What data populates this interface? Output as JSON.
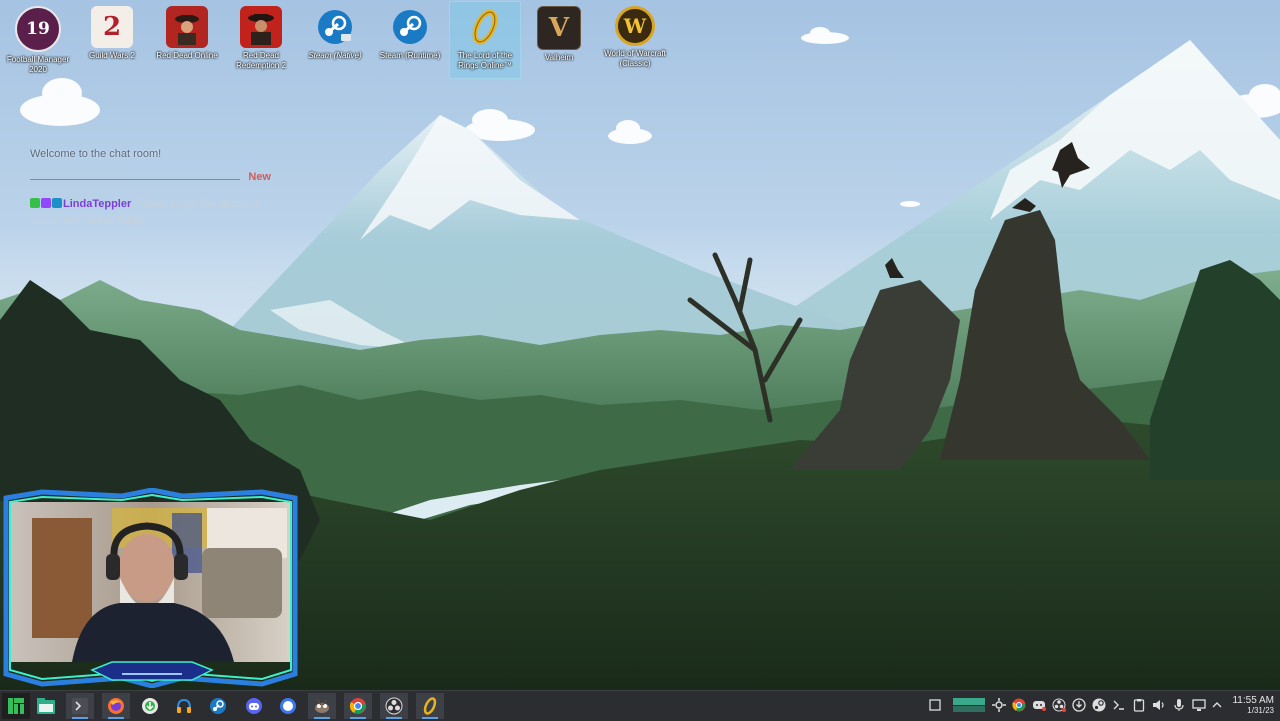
{
  "desktop": {
    "icons": [
      {
        "label": "Football Manager 2020",
        "icon": "football-manager-icon",
        "glyph": "19"
      },
      {
        "label": "Guild Wars 2",
        "icon": "guild-wars-2-icon",
        "glyph": "2"
      },
      {
        "label": "Red Dead Online",
        "icon": "red-dead-online-icon",
        "glyph": ""
      },
      {
        "label": "Red Dead Redemption 2",
        "icon": "red-dead-redemption-2-icon",
        "glyph": ""
      },
      {
        "label": "Steam (Native)",
        "icon": "steam-icon",
        "glyph": ""
      },
      {
        "label": "Steam (Runtime)",
        "icon": "steam-icon",
        "glyph": ""
      },
      {
        "label": "The Lord of the Rings Online™",
        "icon": "lotro-ring-icon",
        "glyph": ""
      },
      {
        "label": "Valheim",
        "icon": "valheim-icon",
        "glyph": "V"
      },
      {
        "label": "World of Warcraft (Classic)",
        "icon": "wow-icon",
        "glyph": "W"
      }
    ]
  },
  "chat": {
    "welcome": "Welcome to the chat room!",
    "new_label": "New",
    "messages": [
      {
        "user": "LindaTeppler",
        "text": ": I have to get the account bound fast mount thing"
      }
    ]
  },
  "taskbar": {
    "apps": [
      {
        "name": "manjaro-menu-icon"
      },
      {
        "name": "file-manager-icon"
      },
      {
        "name": "terminal-icon"
      },
      {
        "name": "firefox-icon"
      },
      {
        "name": "update-manager-icon"
      },
      {
        "name": "headset-app-icon"
      },
      {
        "name": "steam-icon"
      },
      {
        "name": "discord-icon"
      },
      {
        "name": "signal-icon"
      },
      {
        "name": "gimp-icon"
      },
      {
        "name": "chrome-icon"
      },
      {
        "name": "obs-icon"
      },
      {
        "name": "lotro-ring-icon"
      }
    ],
    "tray": [
      {
        "name": "show-desktop-icon"
      },
      {
        "name": "virtual-desktops-icon"
      },
      {
        "name": "tray-settings-icon"
      },
      {
        "name": "tray-chrome-icon"
      },
      {
        "name": "tray-discord-icon"
      },
      {
        "name": "tray-obs-icon"
      },
      {
        "name": "tray-update-icon"
      },
      {
        "name": "tray-steam-icon"
      },
      {
        "name": "tray-terminal-icon"
      },
      {
        "name": "tray-clipboard-icon"
      },
      {
        "name": "volume-icon"
      },
      {
        "name": "microphone-icon"
      },
      {
        "name": "network-icon"
      },
      {
        "name": "tray-expand-icon"
      }
    ],
    "time": "11:55 AM",
    "date": "1/31/23"
  },
  "colors": {
    "taskbar": "#2b2d30",
    "chat_user": "#7c3fd6",
    "new_marker": "#d45b5b",
    "sky": "#a9c9e6"
  }
}
